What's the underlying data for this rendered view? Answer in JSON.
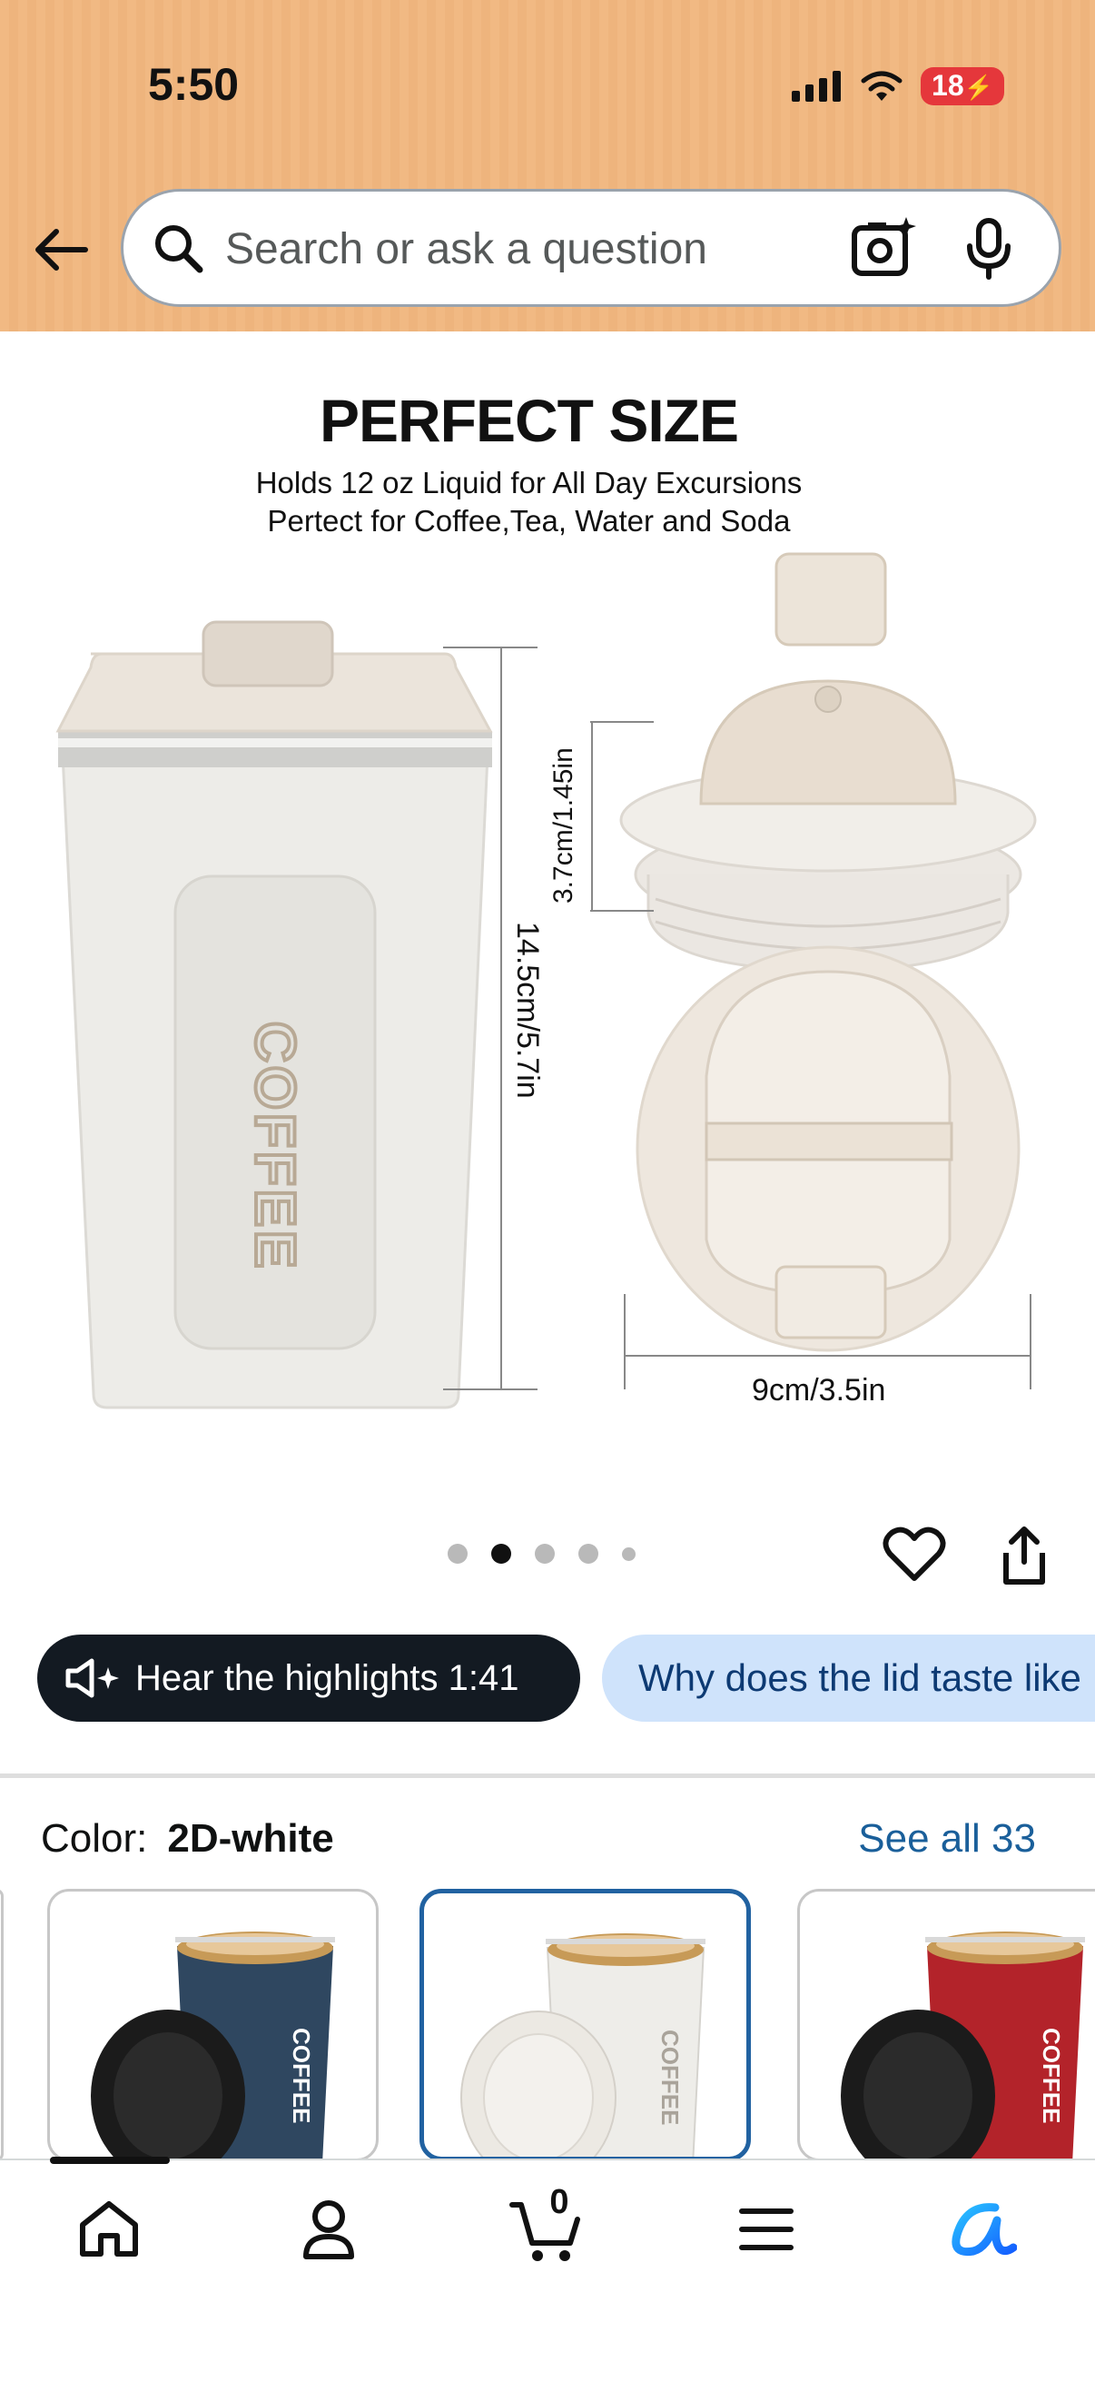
{
  "status_bar": {
    "time": "5:50",
    "battery": "18"
  },
  "search": {
    "placeholder": "Search or ask a question"
  },
  "product_image": {
    "title": "PERFECT SIZE",
    "subtitle_line1": "Holds 12 oz Liquid for All Day Excursions",
    "subtitle_line2": "Pertect for Coffee,Tea, Water and Soda",
    "dim_height": "14.5cm/5.7in",
    "dim_lid_height": "3.7cm/1.45in",
    "dim_diameter": "9cm/3.5in",
    "cup_brand_text": "COFFEE"
  },
  "carousel": {
    "count": 5,
    "active_index": 1
  },
  "pills": {
    "highlights_label": "Hear the highlights 1:41",
    "question_label": "Why does the lid taste like"
  },
  "color_selector": {
    "label": "Color:",
    "selected_value": "2D-white",
    "see_all": "See all 33",
    "swatches": [
      {
        "name": "blue",
        "color": "#2f4760",
        "lid": "#1b1b1b",
        "brand": "COFFEE",
        "selected": false
      },
      {
        "name": "white",
        "color": "#eeede9",
        "lid": "#ece9e3",
        "brand": "COFFEE",
        "selected": true
      },
      {
        "name": "red",
        "color": "#b3232a",
        "lid": "#1b1b1b",
        "brand": "COFFEE",
        "selected": false
      }
    ]
  },
  "bottom_nav": {
    "cart_count": "0"
  },
  "colors": {
    "header_bg": "#f1b983",
    "accent_blue": "#2162a1",
    "link_blue": "#1a5f9a",
    "ai_gradient_start": "#29c3ff",
    "ai_gradient_end": "#1460ff"
  }
}
